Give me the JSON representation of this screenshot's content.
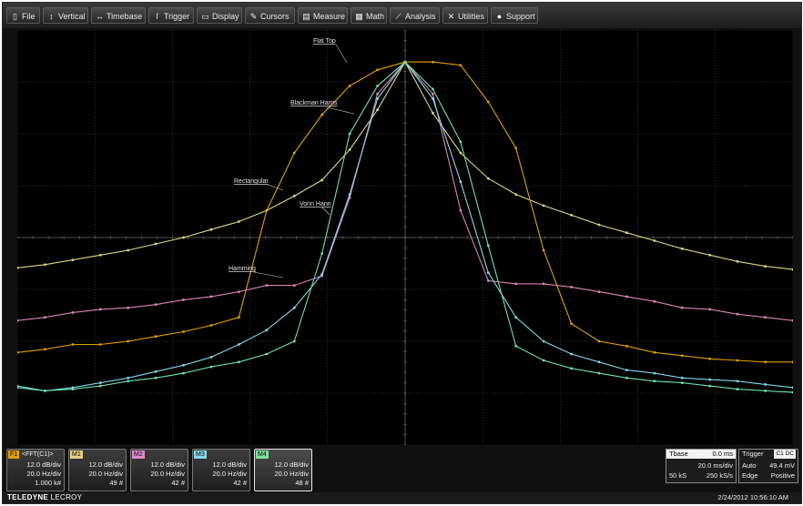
{
  "menu": [
    {
      "label": "File",
      "icon": "file-icon"
    },
    {
      "label": "Vertical",
      "icon": "vertical-icon"
    },
    {
      "label": "Timebase",
      "icon": "timebase-icon"
    },
    {
      "label": "Trigger",
      "icon": "trigger-icon"
    },
    {
      "label": "Display",
      "icon": "display-icon"
    },
    {
      "label": "Cursors",
      "icon": "cursors-icon"
    },
    {
      "label": "Measure",
      "icon": "measure-icon"
    },
    {
      "label": "Math",
      "icon": "math-icon"
    },
    {
      "label": "Analysis",
      "icon": "analysis-icon"
    },
    {
      "label": "Utilities",
      "icon": "utilities-icon"
    },
    {
      "label": "Support",
      "icon": "support-icon"
    }
  ],
  "traces": [
    {
      "name": "Flat Top",
      "color": "#e0a000",
      "values": [
        5.8,
        6.0,
        6.3,
        6.3,
        6.5,
        6.8,
        7.1,
        7.5,
        8.0,
        14.7,
        18.3,
        20.7,
        22.5,
        23.5,
        24.0,
        24.0,
        23.8,
        21.5,
        18.6,
        12.2,
        7.6,
        6.5,
        6.2,
        5.8,
        5.6,
        5.4,
        5.3,
        5.2,
        5.2
      ]
    },
    {
      "name": "Blackman Harris",
      "color": "#70e0b0",
      "values": [
        3.6,
        3.4,
        3.5,
        3.7,
        4.0,
        4.2,
        4.5,
        4.9,
        5.2,
        5.7,
        6.5,
        12.0,
        19.5,
        22.5,
        24.0,
        22.3,
        19.0,
        12.5,
        6.2,
        5.3,
        4.8,
        4.5,
        4.2,
        4.0,
        3.9,
        3.7,
        3.5,
        3.4,
        3.3
      ]
    },
    {
      "name": "Rectangular",
      "color": "#d8d880",
      "values": [
        11.1,
        11.3,
        11.6,
        11.9,
        12.2,
        12.6,
        13.0,
        13.5,
        14.0,
        14.7,
        15.6,
        16.6,
        18.5,
        21.0,
        24.0,
        20.8,
        18.3,
        16.7,
        15.7,
        15.0,
        14.4,
        13.8,
        13.3,
        12.8,
        12.3,
        11.9,
        11.5,
        11.2,
        11.0
      ]
    },
    {
      "name": "Vonn Hann",
      "color": "#80d8e8",
      "values": [
        3.7,
        3.4,
        3.6,
        3.9,
        4.2,
        4.6,
        5.0,
        5.5,
        6.3,
        7.2,
        8.6,
        10.7,
        15.7,
        21.7,
        24.0,
        21.7,
        16.5,
        10.8,
        8.0,
        6.5,
        5.7,
        5.2,
        4.7,
        4.5,
        4.2,
        4.1,
        4.0,
        3.8,
        3.6
      ]
    },
    {
      "name": "Hamming",
      "color": "#d884b8",
      "values": [
        7.8,
        8.0,
        8.3,
        8.5,
        8.6,
        8.8,
        9.1,
        9.3,
        9.6,
        10.0,
        10.0,
        10.6,
        15.5,
        22.0,
        24.0,
        22.0,
        14.7,
        10.3,
        10.1,
        10.1,
        9.9,
        9.6,
        9.3,
        9.0,
        8.6,
        8.5,
        8.2,
        8.0,
        7.8
      ]
    }
  ],
  "trace_labels": [
    "Flat Top",
    "Blackman Harris",
    "Rectangular",
    "Vonn Hann",
    "Hamming"
  ],
  "descriptors": [
    {
      "tag": "F1",
      "tag_color": "#e0a000",
      "source": "<FFT(C1)>",
      "line1": "12.0 dB/div",
      "line2": "20.0 Hz/div",
      "line3": "1.000 k#",
      "active": false
    },
    {
      "tag": "M1",
      "tag_color": "#e0d080",
      "source": "",
      "line1": "12.0 dB/div",
      "line2": "20.0 Hz/div",
      "line3": "49 #",
      "active": false
    },
    {
      "tag": "M2",
      "tag_color": "#e08cc8",
      "source": "",
      "line1": "12.0 dB/div",
      "line2": "20.0 Hz/div",
      "line3": "42 #",
      "active": false
    },
    {
      "tag": "M3",
      "tag_color": "#88d8e8",
      "source": "",
      "line1": "12.0 dB/div",
      "line2": "20.0 Hz/div",
      "line3": "42 #",
      "active": false
    },
    {
      "tag": "M4",
      "tag_color": "#80e0a0",
      "source": "",
      "line1": "12.0 dB/div",
      "line2": "20.0 Hz/div",
      "line3": "48 #",
      "active": true
    }
  ],
  "timebase": {
    "title": "Tbase",
    "offset": "0.0 ms",
    "rate": "20.0 ms/div",
    "samples": "50 kS",
    "sample_rate": "250 kS/s"
  },
  "trigger": {
    "title": "Trigger",
    "badge": "C1 DC",
    "mode": "Auto",
    "level": "49.4 mV",
    "type": "Edge",
    "slope": "Positive"
  },
  "footer": {
    "brand": "TELEDYNE",
    "brand2": "LECROY",
    "datetime": "2/24/2012 10:56:10 AM"
  },
  "axis": {
    "ylim": [
      0,
      26
    ],
    "points": 29
  }
}
